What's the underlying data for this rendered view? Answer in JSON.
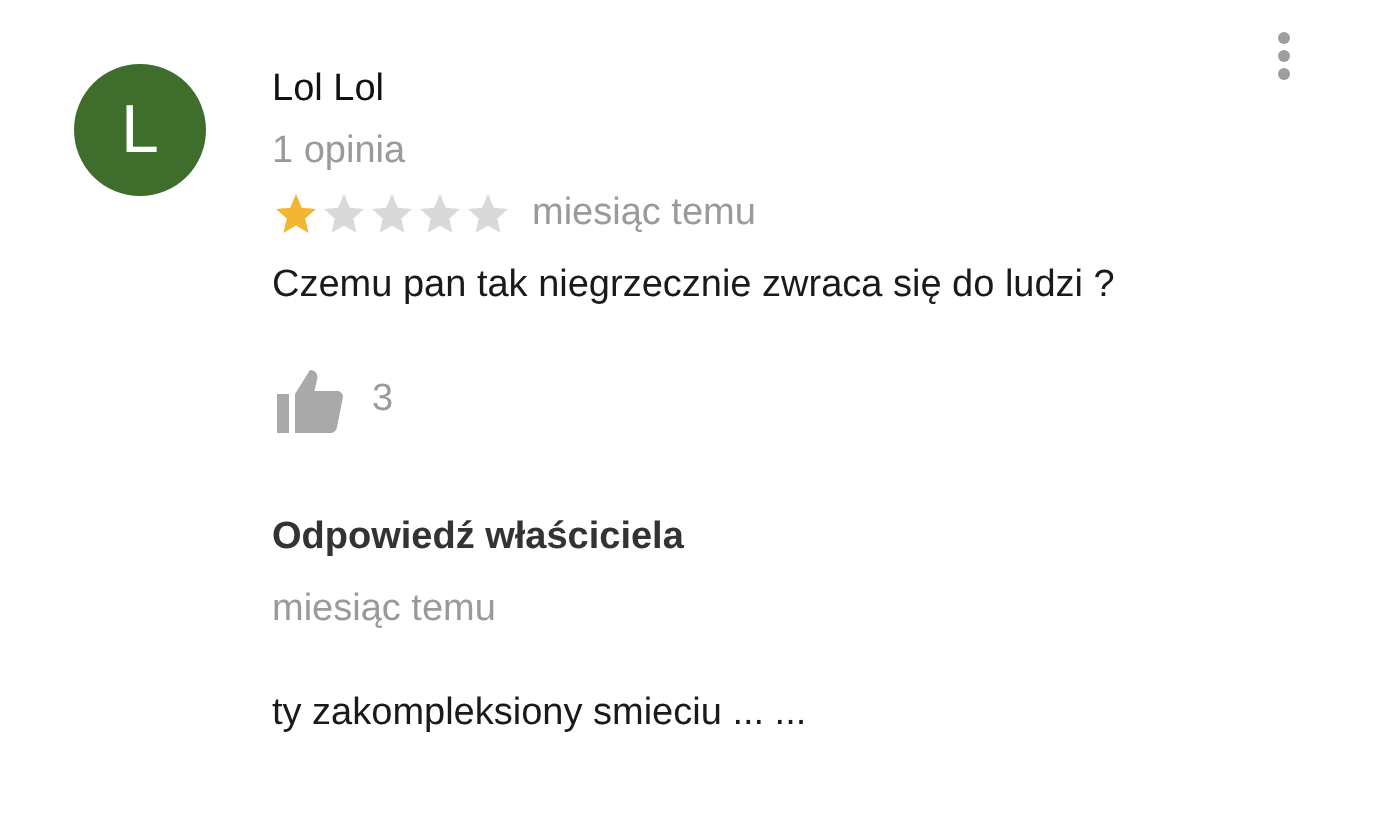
{
  "review": {
    "avatar_letter": "L",
    "author": "Lol Lol",
    "review_count": "1 opinia",
    "stars": 1,
    "date": "miesiąc temu",
    "text": "Czemu pan tak niegrzecznie zwraca się do ludzi ?",
    "likes": "3"
  },
  "owner_reply": {
    "title": "Odpowiedź właściciela",
    "date": "miesiąc temu",
    "text": "ty zakompleksiony smieciu ... ..."
  }
}
